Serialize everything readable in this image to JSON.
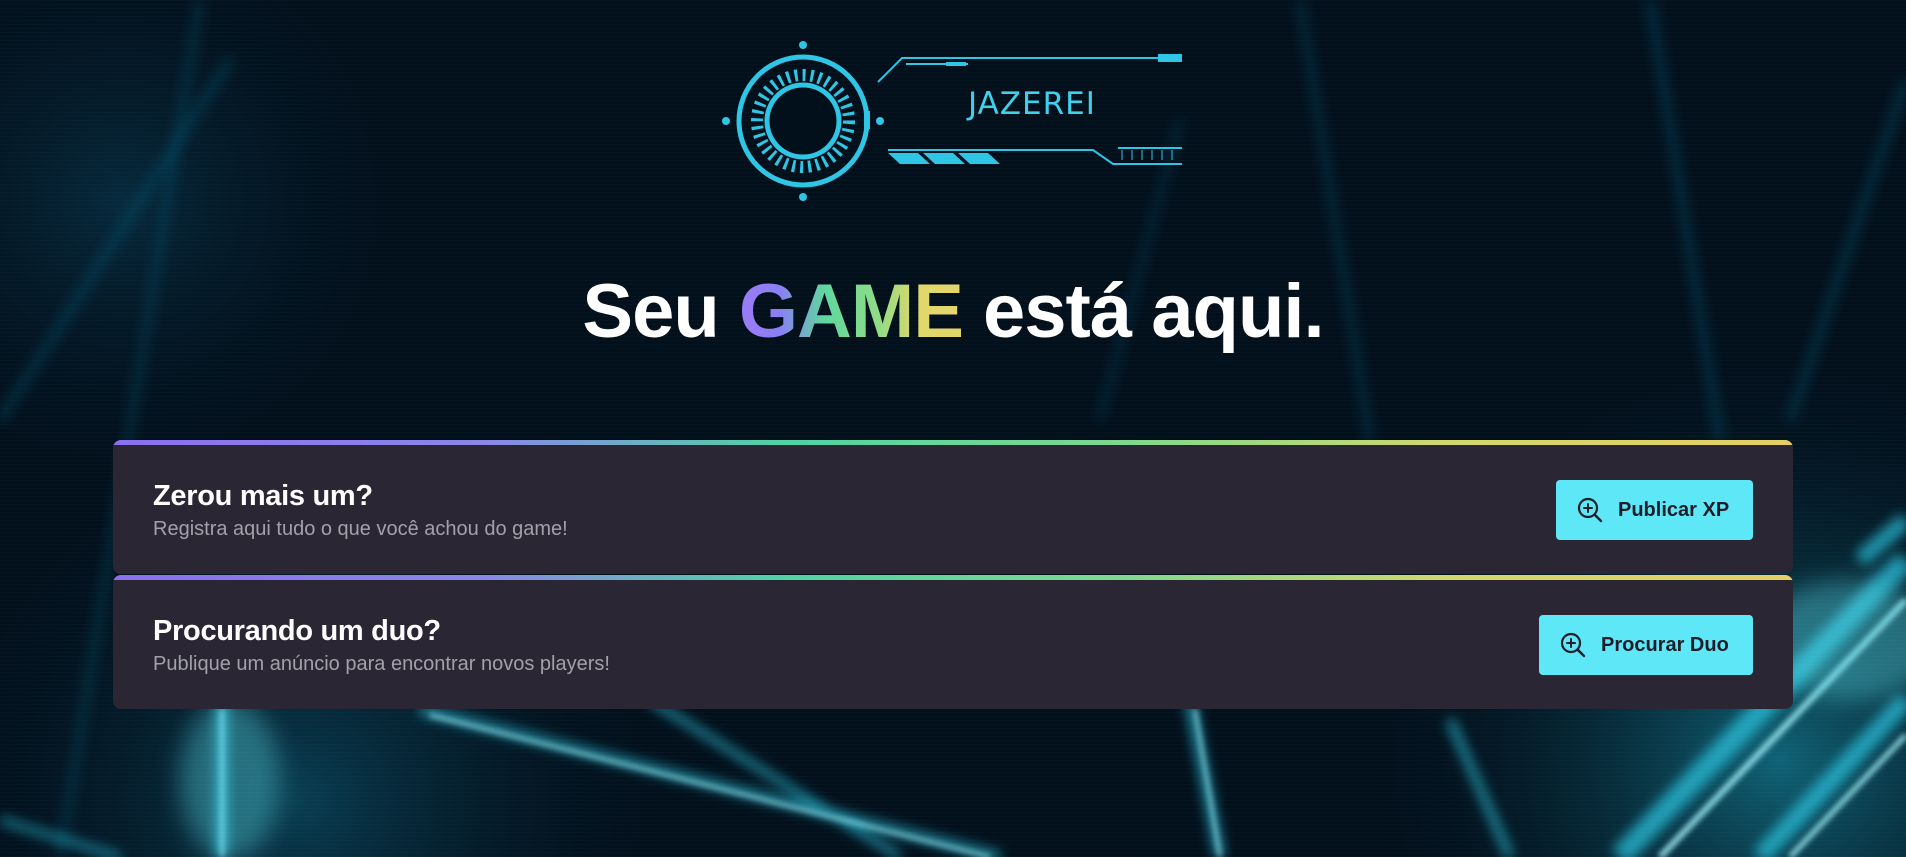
{
  "logo": {
    "text": "JAZEREI",
    "accent": "#3fd0ec"
  },
  "headline": {
    "prefix": "Seu ",
    "highlight": "GAME",
    "suffix": " está aqui."
  },
  "cards": [
    {
      "title": "Zerou mais um?",
      "description": "Registra aqui tudo o que você achou do game!",
      "button_label": "Publicar XP",
      "button_icon": "magnifying-glass-plus-icon"
    },
    {
      "title": "Procurando um duo?",
      "description": "Publique um anúncio para encontrar novos players!",
      "button_label": "Procurar Duo",
      "button_icon": "magnifying-glass-plus-icon"
    }
  ],
  "colors": {
    "background": "#02101c",
    "card_background": "#2a2634",
    "button_background": "#5ee8f7",
    "gradient_start": "#8b6ff1",
    "gradient_mid": "#4fd4a3",
    "gradient_end": "#e6cf66"
  }
}
